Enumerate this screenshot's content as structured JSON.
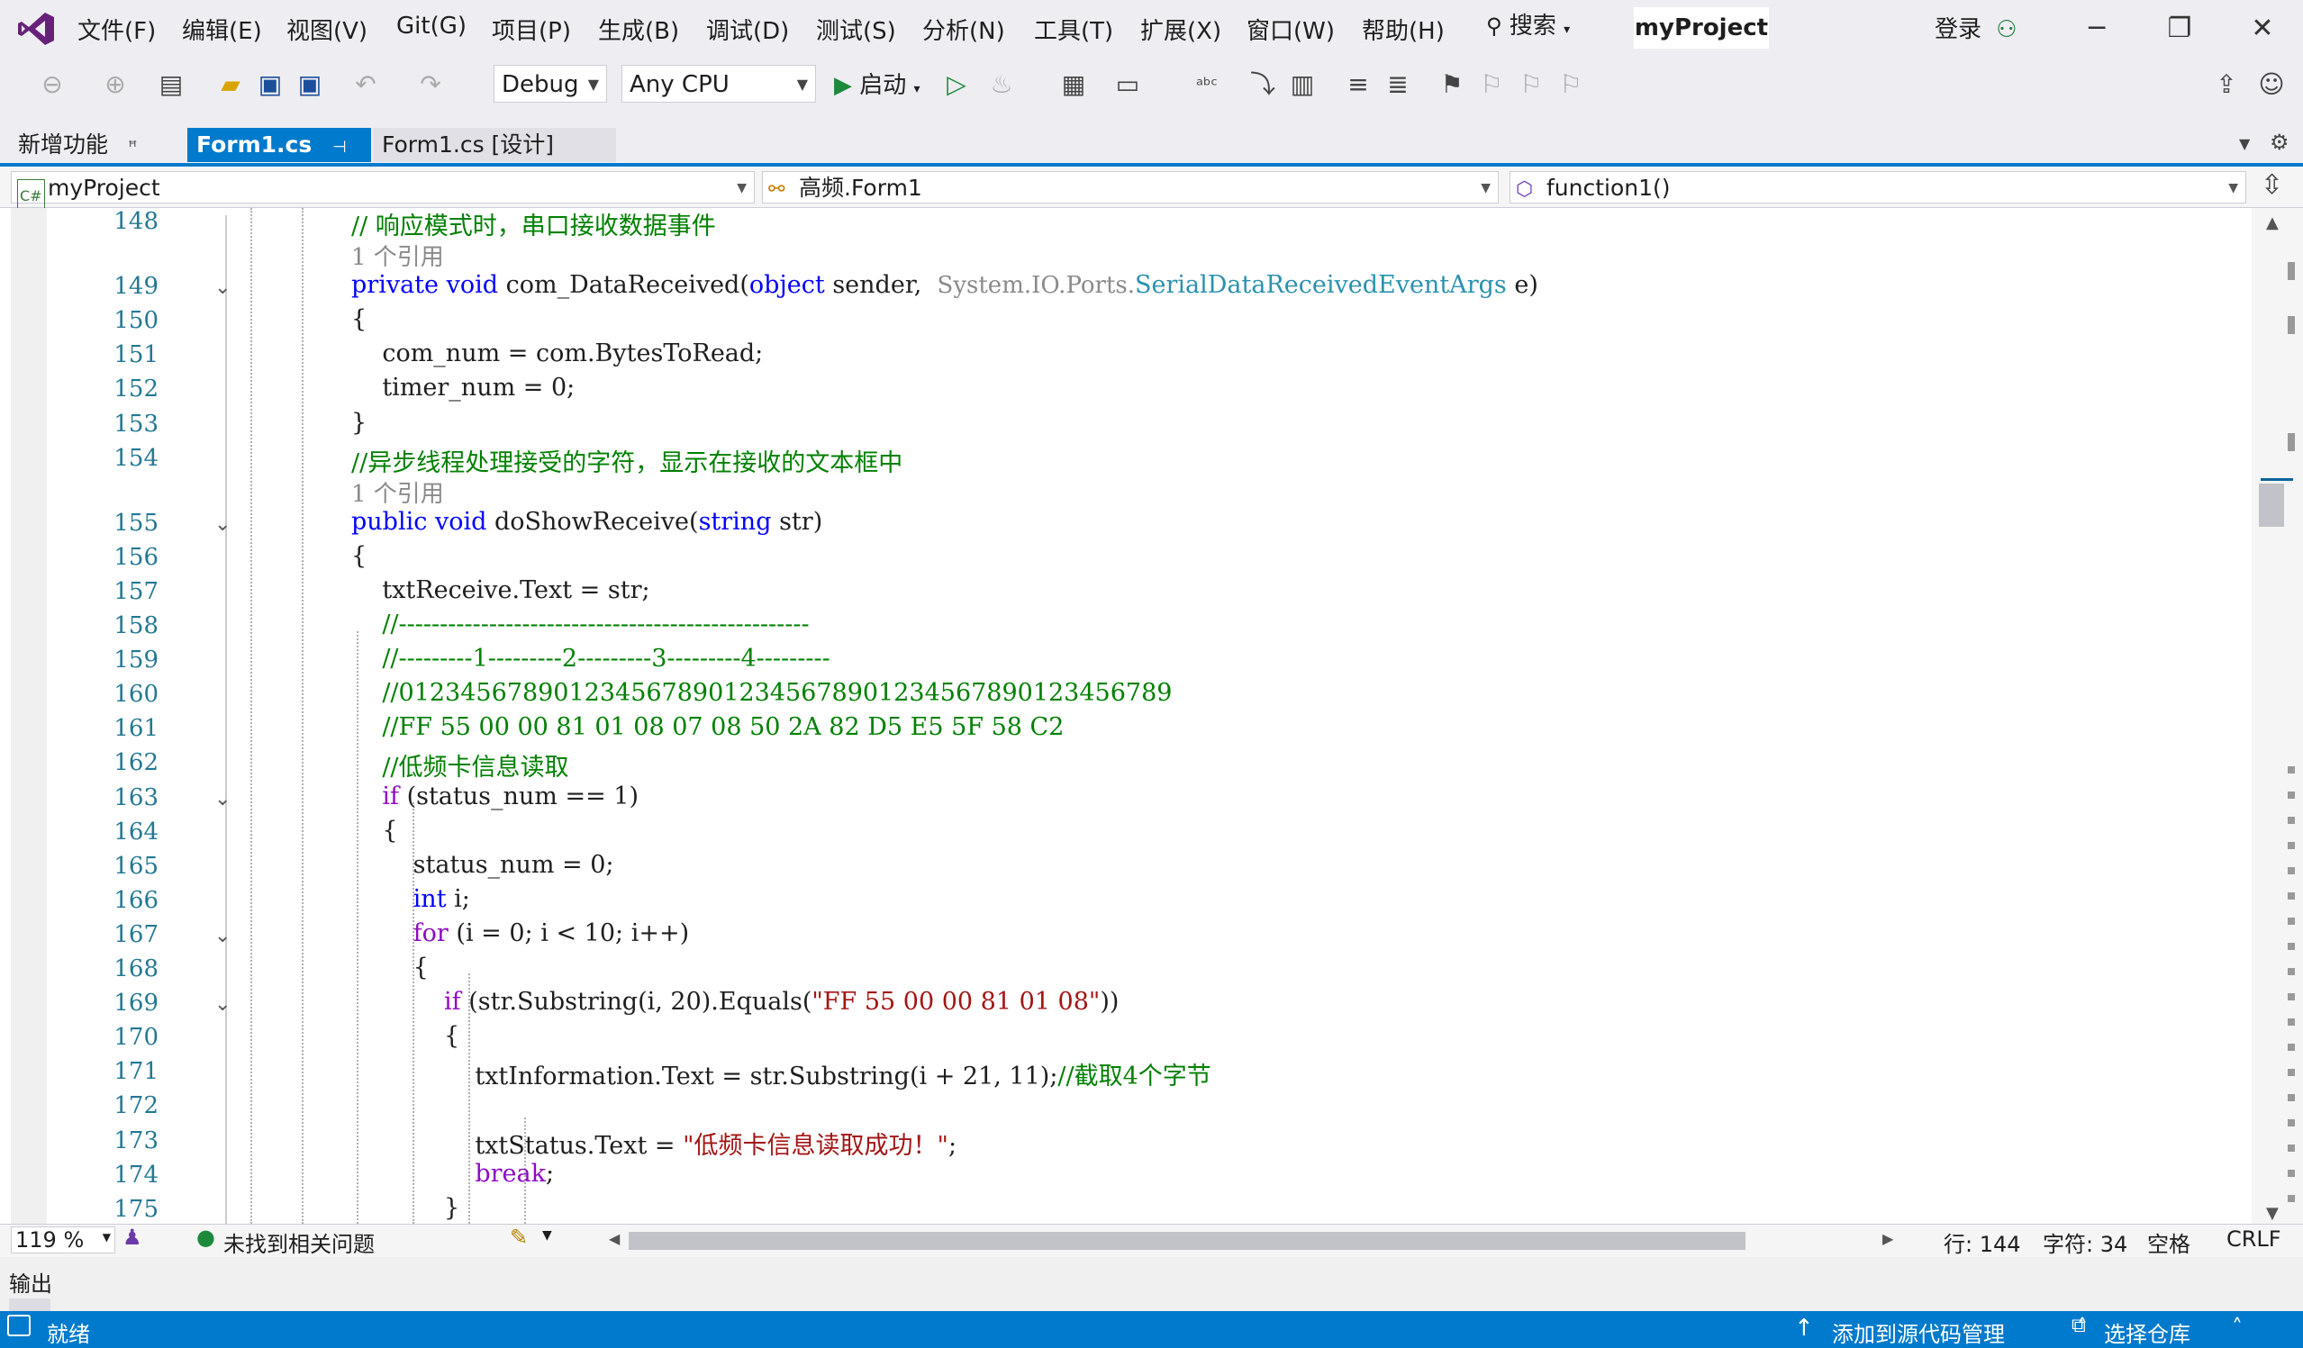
{
  "menu": {
    "items": [
      "文件(F)",
      "编辑(E)",
      "视图(V)",
      "Git(G)",
      "项目(P)",
      "生成(B)",
      "调试(D)",
      "测试(S)",
      "分析(N)",
      "工具(T)",
      "扩展(X)",
      "窗口(W)",
      "帮助(H)"
    ],
    "search_label": "搜索",
    "project_name": "myProject",
    "login_label": "登录"
  },
  "toolbar": {
    "config": "Debug",
    "platform": "Any CPU",
    "start_label": "启动"
  },
  "tabs": [
    {
      "label": "新增功能",
      "active": false
    },
    {
      "label": "Form1.cs",
      "active": true
    },
    {
      "label": "Form1.cs [设计]",
      "active": false
    }
  ],
  "navbar": {
    "project": "myProject",
    "class": "高频.Form1",
    "member": "function1()"
  },
  "editor": {
    "lines": [
      {
        "n": "148",
        "parts": [
          [
            "cm",
            "// 响应模式时，串口接收数据事件"
          ]
        ]
      },
      {
        "ref": "1 个引用"
      },
      {
        "n": "149",
        "fold": true,
        "parts": [
          [
            "kw",
            "private "
          ],
          [
            "kw",
            "void "
          ],
          [
            "",
            "com_DataReceived("
          ],
          [
            "kw",
            "object "
          ],
          [
            "",
            "sender,  "
          ],
          [
            "ref",
            "System.IO.Ports."
          ],
          [
            "ty",
            "SerialDataReceivedEventArgs"
          ],
          [
            "",
            " e)"
          ]
        ]
      },
      {
        "n": "150",
        "parts": [
          [
            "",
            "{"
          ]
        ]
      },
      {
        "n": "151",
        "parts": [
          [
            "",
            "    com_num = com.BytesToRead;"
          ]
        ]
      },
      {
        "n": "152",
        "parts": [
          [
            "",
            "    timer_num = 0;"
          ]
        ]
      },
      {
        "n": "153",
        "parts": [
          [
            "",
            "}"
          ]
        ]
      },
      {
        "n": "154",
        "parts": [
          [
            "cm",
            "//异步线程处理接受的字符，显示在接收的文本框中"
          ]
        ]
      },
      {
        "ref": "1 个引用"
      },
      {
        "n": "155",
        "fold": true,
        "parts": [
          [
            "kw",
            "public "
          ],
          [
            "kw",
            "void "
          ],
          [
            "",
            "doShowReceive("
          ],
          [
            "kw",
            "string "
          ],
          [
            "",
            "str)"
          ]
        ]
      },
      {
        "n": "156",
        "parts": [
          [
            "",
            "{"
          ]
        ]
      },
      {
        "n": "157",
        "parts": [
          [
            "",
            "    txtReceive.Text = str;"
          ]
        ]
      },
      {
        "n": "158",
        "parts": [
          [
            "cm",
            "    //--------------------------------------------------"
          ]
        ]
      },
      {
        "n": "159",
        "parts": [
          [
            "cm",
            "    //---------1---------2---------3---------4---------"
          ]
        ]
      },
      {
        "n": "160",
        "parts": [
          [
            "cm",
            "    //01234567890123456789012345678901234567890123456789"
          ]
        ]
      },
      {
        "n": "161",
        "parts": [
          [
            "cm",
            "    //FF 55 00 00 81 01 08 07 08 50 2A 82 D5 E5 5F 58 C2"
          ]
        ]
      },
      {
        "n": "162",
        "parts": [
          [
            "cm",
            "    //低频卡信息读取"
          ]
        ]
      },
      {
        "n": "163",
        "fold": true,
        "parts": [
          [
            "",
            "    "
          ],
          [
            "ctl",
            "if "
          ],
          [
            "",
            "(status_num == 1)"
          ]
        ]
      },
      {
        "n": "164",
        "parts": [
          [
            "",
            "    {"
          ]
        ]
      },
      {
        "n": "165",
        "parts": [
          [
            "",
            "        status_num = 0;"
          ]
        ]
      },
      {
        "n": "166",
        "parts": [
          [
            "",
            "        "
          ],
          [
            "kw",
            "int "
          ],
          [
            "",
            "i;"
          ]
        ]
      },
      {
        "n": "167",
        "fold": true,
        "parts": [
          [
            "",
            "        "
          ],
          [
            "ctl",
            "for "
          ],
          [
            "",
            "(i = 0; i < 10; i++)"
          ]
        ]
      },
      {
        "n": "168",
        "parts": [
          [
            "",
            "        {"
          ]
        ]
      },
      {
        "n": "169",
        "fold": true,
        "parts": [
          [
            "",
            "            "
          ],
          [
            "ctl",
            "if "
          ],
          [
            "",
            "(str.Substring(i, 20).Equals("
          ],
          [
            "st",
            "\"FF 55 00 00 81 01 08\""
          ],
          [
            "",
            "))"
          ]
        ]
      },
      {
        "n": "170",
        "parts": [
          [
            "",
            "            {"
          ]
        ]
      },
      {
        "n": "171",
        "parts": [
          [
            "",
            "                txtInformation.Text = str.Substring(i + 21, 11);"
          ],
          [
            "cm",
            "//截取4个字节"
          ]
        ]
      },
      {
        "n": "172",
        "parts": [
          [
            "",
            ""
          ]
        ]
      },
      {
        "n": "173",
        "parts": [
          [
            "",
            "                txtStatus.Text = "
          ],
          [
            "st",
            "\"低频卡信息读取成功！\""
          ],
          [
            "",
            ";"
          ]
        ]
      },
      {
        "n": "174",
        "parts": [
          [
            "",
            "                "
          ],
          [
            "ctl",
            "break"
          ],
          [
            "",
            ";"
          ]
        ]
      },
      {
        "n": "175",
        "parts": [
          [
            "",
            "            }"
          ]
        ]
      }
    ]
  },
  "editor_status": {
    "zoom": "119 %",
    "issues": "未找到相关问题",
    "line": "行: 144",
    "col": "字符: 34",
    "whitespace": "空格",
    "eol": "CRLF"
  },
  "output_panel": {
    "label": "输出"
  },
  "statusbar": {
    "ready": "就绪",
    "source_control": "添加到源代码管理",
    "repo": "选择仓库"
  },
  "colors": {
    "accent": "#007acc",
    "keyword": "#0000ff",
    "type": "#2b91af",
    "comment": "#008000",
    "string": "#a31515",
    "control": "#8f08c4"
  }
}
